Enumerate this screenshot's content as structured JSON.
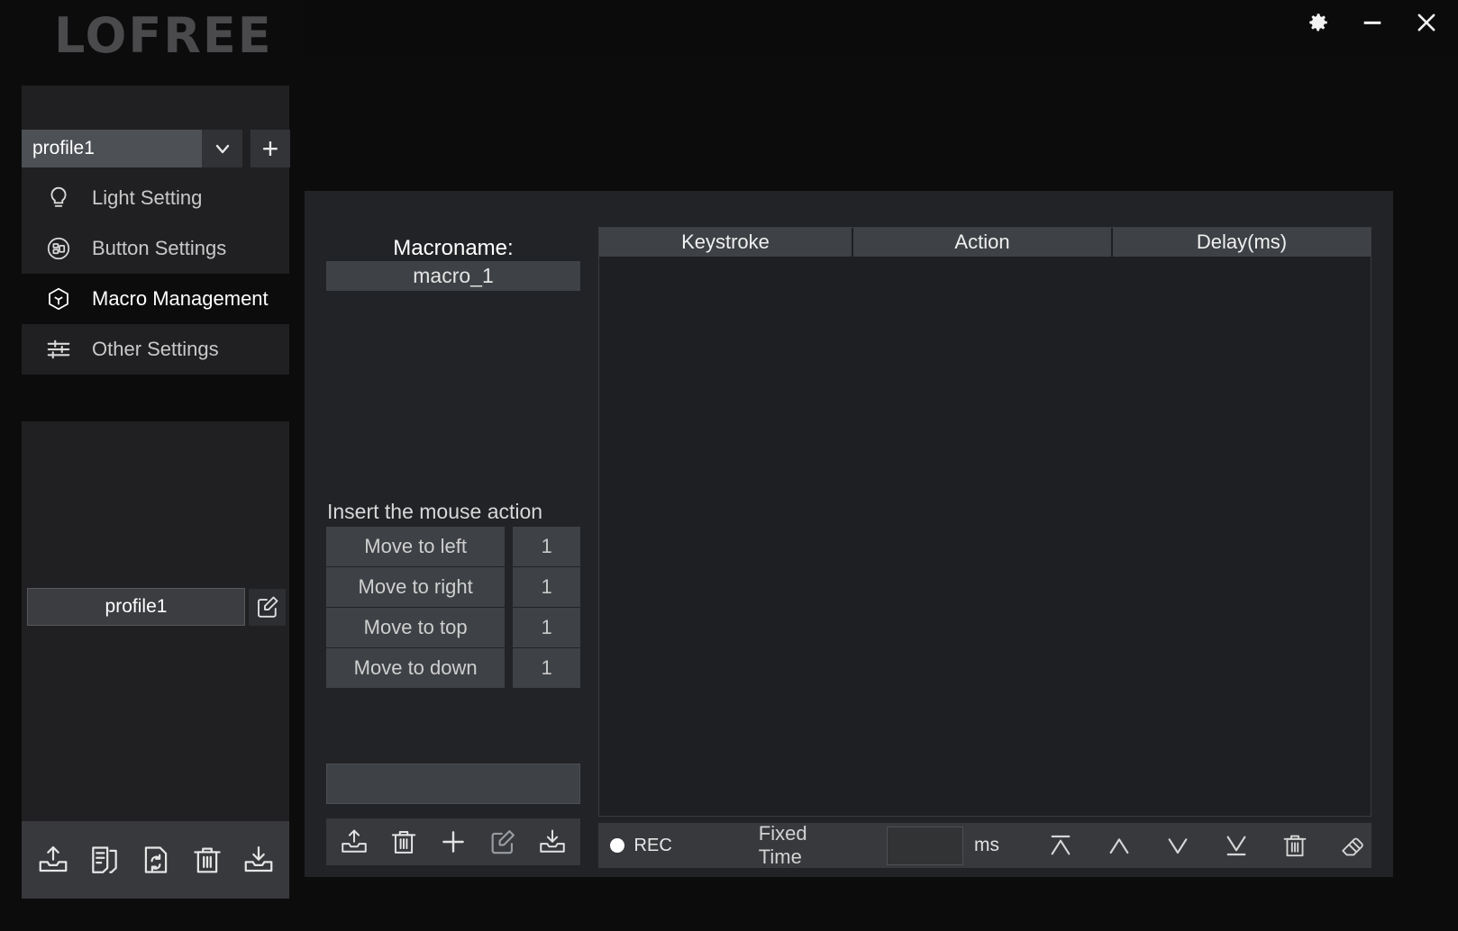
{
  "window": {
    "brand": "LOFREE",
    "controls": [
      {
        "name": "settings-button",
        "icon": "gear-icon",
        "label": "Settings"
      },
      {
        "name": "minimize-button",
        "icon": "minimize-icon",
        "label": "Minimize"
      },
      {
        "name": "close-button",
        "icon": "close-icon",
        "label": "Close"
      }
    ]
  },
  "sidebar": {
    "profile_selector": {
      "value": "profile1",
      "caret_icon": "chevron-down-icon",
      "add_icon": "plus-icon",
      "add_label": "+"
    },
    "nav_items": [
      {
        "label": "Light Setting",
        "icon": "bulb-icon",
        "selected": false
      },
      {
        "label": "Button Settings",
        "icon": "button-circle-icon",
        "selected": false
      },
      {
        "label": "Macro Management",
        "icon": "cube-icon",
        "selected": true
      },
      {
        "label": "Other Settings",
        "icon": "sliders-icon",
        "selected": false
      }
    ],
    "profile_list": [
      {
        "label": "profile1",
        "edit_icon": "edit-square-icon"
      }
    ],
    "toolbar": [
      {
        "name": "export-profile-button",
        "icon": "export-tray-icon"
      },
      {
        "name": "duplicate-profile-button",
        "icon": "copy-document-icon"
      },
      {
        "name": "reset-profile-button",
        "icon": "refresh-document-icon"
      },
      {
        "name": "delete-profile-button",
        "icon": "trash-icon"
      },
      {
        "name": "import-profile-button",
        "icon": "import-tray-icon"
      }
    ]
  },
  "main": {
    "macro_name_label": "Macroname:",
    "macro_name_value": "macro_1",
    "insert_mouse_action_label": "Insert the mouse action",
    "mouse_actions": [
      {
        "label": "Move to left",
        "value": "1"
      },
      {
        "label": "Move to right",
        "value": "1"
      },
      {
        "label": "Move to top",
        "value": "1"
      },
      {
        "label": "Move to down",
        "value": "1"
      }
    ],
    "macro_textbox_value": "",
    "macro_toolbar": [
      {
        "name": "export-macro-button",
        "icon": "export-tray-icon"
      },
      {
        "name": "delete-macro-button",
        "icon": "trash-icon"
      },
      {
        "name": "add-macro-button",
        "icon": "plus-icon"
      },
      {
        "name": "rename-macro-button",
        "icon": "edit-square-icon"
      },
      {
        "name": "import-macro-button",
        "icon": "import-tray-icon"
      }
    ],
    "table": {
      "columns": [
        "Keystroke",
        "Action",
        "Delay(ms)"
      ],
      "rows": []
    },
    "rec_bar": {
      "rec_label": "REC",
      "rec_dot_icon": "record-dot-icon",
      "fixed_time_label": "Fixed Time",
      "ms_value": "",
      "ms_label": "ms",
      "controls": [
        {
          "name": "move-to-top-button",
          "icon": "move-to-top-icon"
        },
        {
          "name": "move-up-button",
          "icon": "chevron-up-icon"
        },
        {
          "name": "move-down-button",
          "icon": "chevron-down-icon"
        },
        {
          "name": "move-to-bottom-button",
          "icon": "move-to-bottom-icon"
        },
        {
          "name": "delete-row-button",
          "icon": "trash-icon"
        },
        {
          "name": "clear-all-button",
          "icon": "eraser-icon"
        }
      ]
    }
  },
  "colors": {
    "app_bg": "#0c0c0d",
    "panel_bg": "#222326",
    "control_bg": "#3e4145",
    "toolbar_bg": "#37393c",
    "text": "#e6e6e6"
  }
}
